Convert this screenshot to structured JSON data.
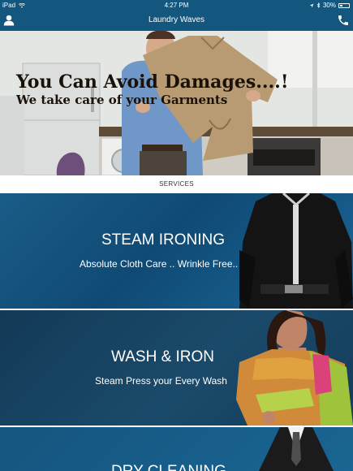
{
  "status": {
    "device": "iPad",
    "time": "4:27 PM",
    "battery": "30%"
  },
  "app": {
    "title": "Laundry Waves"
  },
  "hero": {
    "headline": "You Can Avoid Damages....!",
    "tagline": "We take care of your Garments"
  },
  "section": {
    "label": "SERVICES"
  },
  "services": [
    {
      "title": "STEAM IRONING",
      "subtitle": "Absolute Cloth Care .. Wrinkle Free.."
    },
    {
      "title": "WASH & IRON",
      "subtitle": "Steam Press your Every Wash"
    },
    {
      "title": "DRY CLEANING",
      "subtitle": ""
    }
  ],
  "colors": {
    "bar": "#14577e",
    "card_blue": "#1a5d88",
    "card_dark": "#133a57"
  },
  "icons": {
    "profile": "user-icon",
    "call": "phone-icon"
  }
}
